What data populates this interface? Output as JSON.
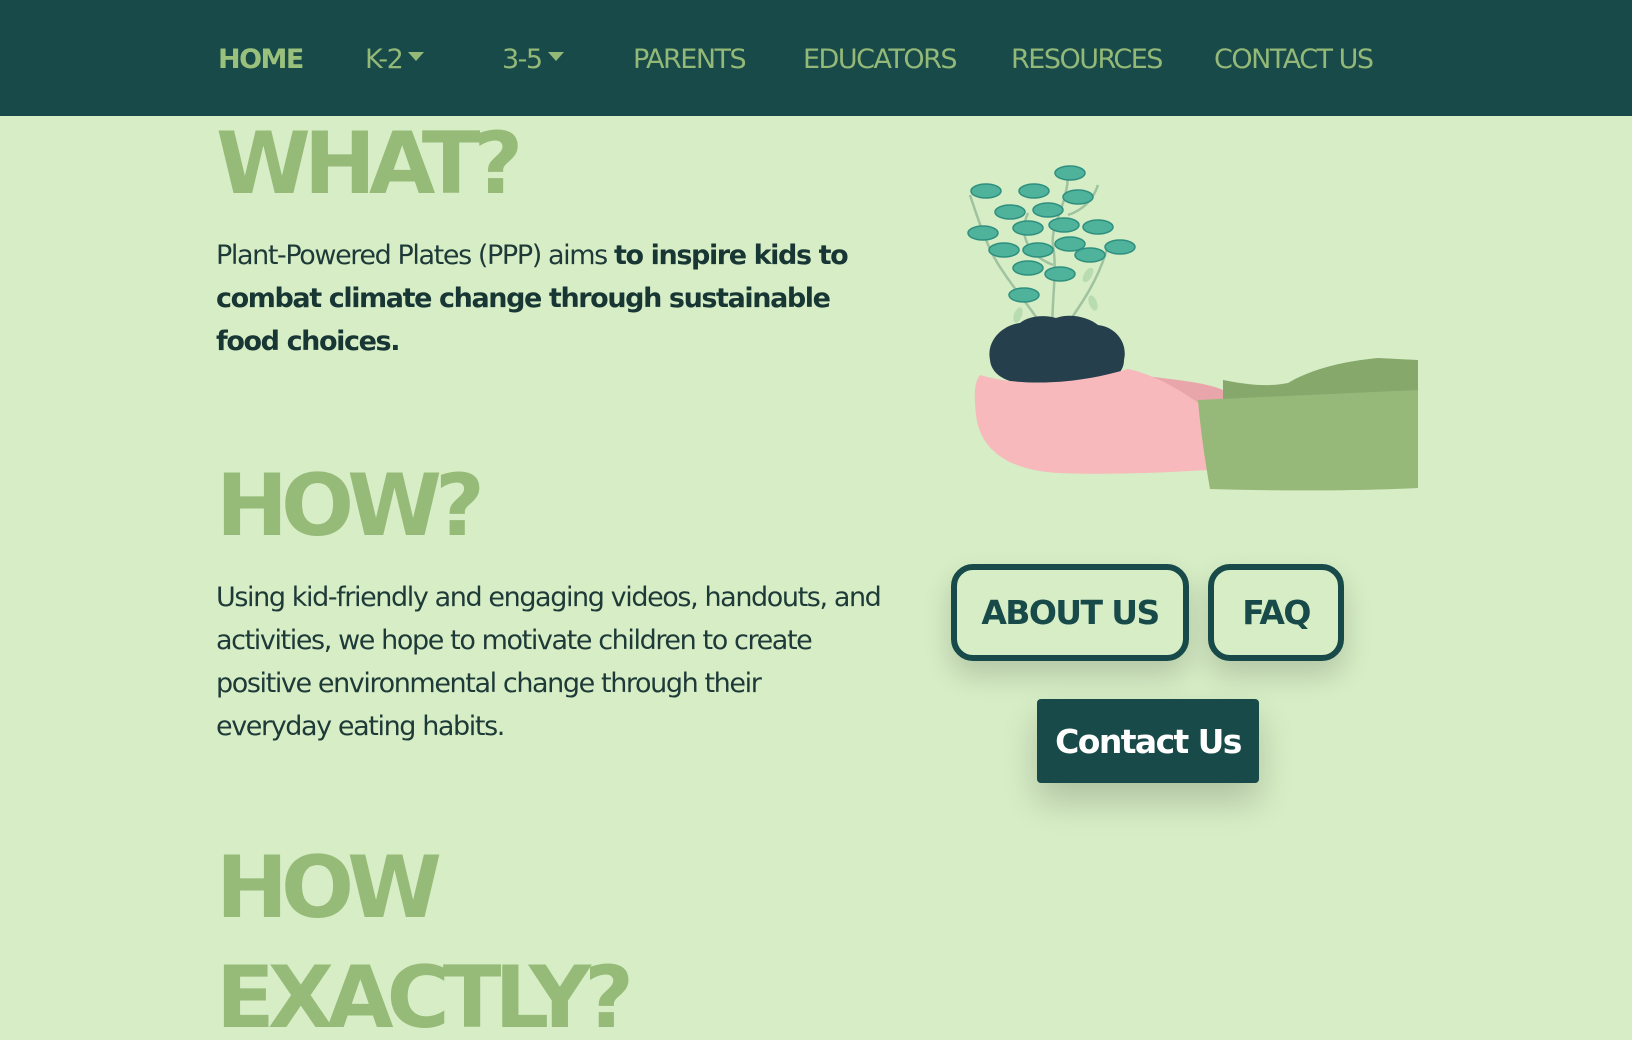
{
  "nav": {
    "home": "HOME",
    "k2": "K-2",
    "grades35": "3-5",
    "parents": "PARENTS",
    "educators": "EDUCATORS",
    "resources": "RESOURCES",
    "contact": "CONTACT US"
  },
  "what": {
    "heading": "WHAT?",
    "intro": "Plant-Powered Plates (PPP) aims ",
    "emphasis": "to inspire kids to combat climate change through sustainable food choices."
  },
  "how": {
    "heading": "HOW?",
    "text": "Using kid-friendly and engaging videos, handouts, and activities, we hope to motivate children to create positive environmental change through their everyday eating habits."
  },
  "how_exactly": {
    "line1": "HOW",
    "line2": "EXACTLY?"
  },
  "buttons": {
    "about": "ABOUT US",
    "faq": "FAQ",
    "contact": "Contact Us"
  },
  "illustration": {
    "icon": "hand-holding-plant-icon"
  },
  "colors": {
    "navbar_bg": "#174a49",
    "page_bg": "#d6edc5",
    "heading": "#96bb78",
    "nav_text": "#93b877",
    "button_dark": "#174a49",
    "hand_pink": "#f7b9bb",
    "sleeve_green": "#96b878",
    "leaf_teal": "#4fb39c",
    "soil_dark": "#253f4c"
  }
}
